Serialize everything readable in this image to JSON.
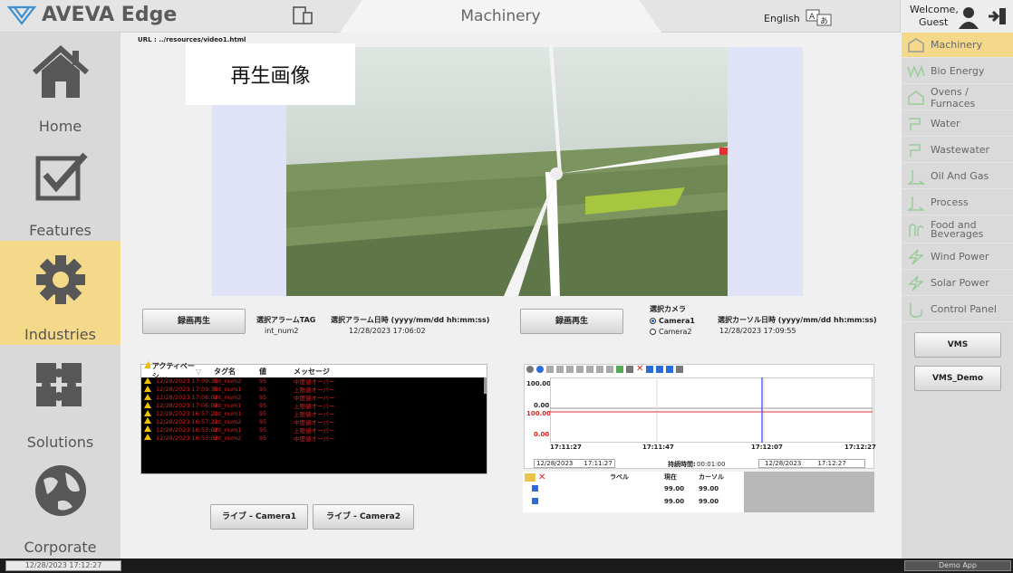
{
  "app": {
    "logo_text": "AVEVA Edge",
    "title": "Machinery",
    "language": "English",
    "welcome_line1": "Welcome,",
    "welcome_line2": "Guest"
  },
  "leftnav": [
    {
      "label": "Home",
      "icon": "home-icon"
    },
    {
      "label": "Features",
      "icon": "checkbox-icon"
    },
    {
      "label": "Industries",
      "icon": "gear-icon"
    },
    {
      "label": "Solutions",
      "icon": "puzzle-icon"
    },
    {
      "label": "Corporate",
      "icon": "globe-icon"
    }
  ],
  "rightnav": {
    "items": [
      "Machinery",
      "Bio Energy",
      "Ovens / Furnaces",
      "Water",
      "Wastewater",
      "Oil And Gas",
      "Process",
      "Food and Beverages",
      "Wind Power",
      "Solar Power",
      "Control Panel"
    ],
    "buttons": [
      "VMS",
      "VMS_Demo"
    ]
  },
  "main": {
    "url": "URL : ../resources/video1.html",
    "video_caption": "再生画像",
    "btn_playback1": "録画再生",
    "alarm_tag_label": "選択アラームTAG",
    "alarm_tag_value": "int_num2",
    "alarm_dt_label": "選択アラーム日時 (yyyy/mm/dd hh:mm:ss)",
    "alarm_dt_value": "12/28/2023 17:06:02",
    "btn_playback2": "録画再生",
    "camera_label": "選択カメラ",
    "camera1": "Camera1",
    "camera2": "Camera2",
    "cursor_dt_label": "選択カーソル日時 (yyyy/mm/dd hh:mm:ss)",
    "cursor_dt_value": "12/28/2023 17:09:55",
    "btn_live1": "ライブ - Camera1",
    "btn_live2": "ライブ - Camera2"
  },
  "alarm": {
    "columns": [
      "アクティベーシ...",
      "タグ名",
      "値",
      "メッセージ"
    ],
    "rows": [
      [
        "12/28/2023 17:09:35",
        "int_num2",
        "95",
        "中度値オーバー"
      ],
      [
        "12/28/2023 17:09:35",
        "int_num1",
        "95",
        "上限値オーバー"
      ],
      [
        "12/28/2023 17:06:02",
        "int_num2",
        "95",
        "中度値オーバー"
      ],
      [
        "12/28/2023 17:06:02",
        "int_num1",
        "95",
        "上限値オーバー"
      ],
      [
        "12/28/2023 16:57:21",
        "int_num1",
        "95",
        "上限値オーバー"
      ],
      [
        "12/28/2023 16:57:21",
        "int_num2",
        "95",
        "中度値オーバー"
      ],
      [
        "12/28/2023 16:53:02",
        "int_num1",
        "95",
        "上限値オーバー"
      ],
      [
        "12/28/2023 16:53:02",
        "int_num2",
        "95",
        "中度値オーバー"
      ]
    ]
  },
  "trend": {
    "y1_top": "100.00",
    "y1_bottom": "0.00",
    "y2_top": "100.00",
    "y2_bottom": "0.00",
    "times": [
      "17:11:27",
      "17:11:47",
      "17:12:07",
      "17:12:27"
    ],
    "start_date": "12/28/2023",
    "start_time": "17:11:27",
    "duration_label": "持続時間:",
    "duration": "00:01:00",
    "end_date": "12/28/2023",
    "end_time": "17:12:27",
    "grid_headers": [
      "ラベル",
      "現在",
      "カーソル"
    ],
    "grid_rows": [
      [
        "",
        "99.00",
        "99.00"
      ],
      [
        "",
        "99.00",
        "99.00"
      ]
    ]
  },
  "status": {
    "datetime": "12/28/2023 17:12:27",
    "app": "Demo App"
  },
  "colors": {
    "accent": "#f5d98a",
    "alarm_red": "#e02020",
    "trend_blue": "#3a3aff"
  }
}
